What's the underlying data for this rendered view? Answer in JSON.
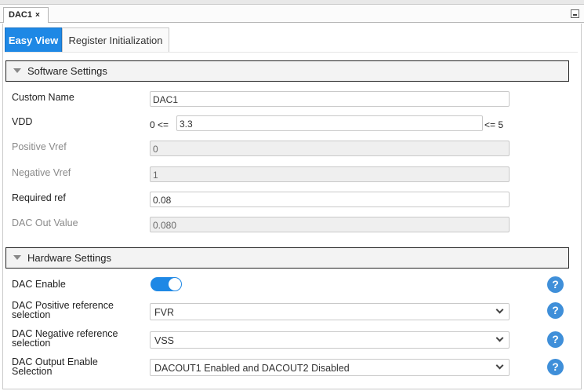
{
  "document_tab": {
    "label": "DAC1",
    "close_glyph": "×"
  },
  "view_tabs": [
    {
      "label": "Easy View",
      "active": true
    },
    {
      "label": "Register Initialization",
      "active": false
    }
  ],
  "software": {
    "title": "Software Settings",
    "custom_name": {
      "label": "Custom Name",
      "value": "DAC1"
    },
    "vdd": {
      "label": "VDD",
      "min_text": "0 <=",
      "value": "3.3",
      "max_text": "<= 5"
    },
    "positive_vref": {
      "label": "Positive Vref",
      "value": "0"
    },
    "negative_vref": {
      "label": "Negative Vref",
      "value": "1"
    },
    "required_ref": {
      "label": "Required ref",
      "value": "0.08"
    },
    "dac_out_value": {
      "label": "DAC Out Value",
      "value": "0.080"
    }
  },
  "hardware": {
    "title": "Hardware Settings",
    "dac_enable": {
      "label": "DAC Enable",
      "enabled": true
    },
    "pos_ref": {
      "label_line1": "DAC Positive reference",
      "label_line2": "selection",
      "value": "FVR"
    },
    "neg_ref": {
      "label_line1": "DAC Negative reference",
      "label_line2": "selection",
      "value": "VSS"
    },
    "output_enable": {
      "label_line1": "DAC Output Enable",
      "label_line2": "Selection",
      "value": "DACOUT1 Enabled and DACOUT2 Disabled"
    },
    "help_glyph": "?"
  },
  "colors": {
    "accent": "#1e88e5",
    "help": "#3f8fd9"
  }
}
